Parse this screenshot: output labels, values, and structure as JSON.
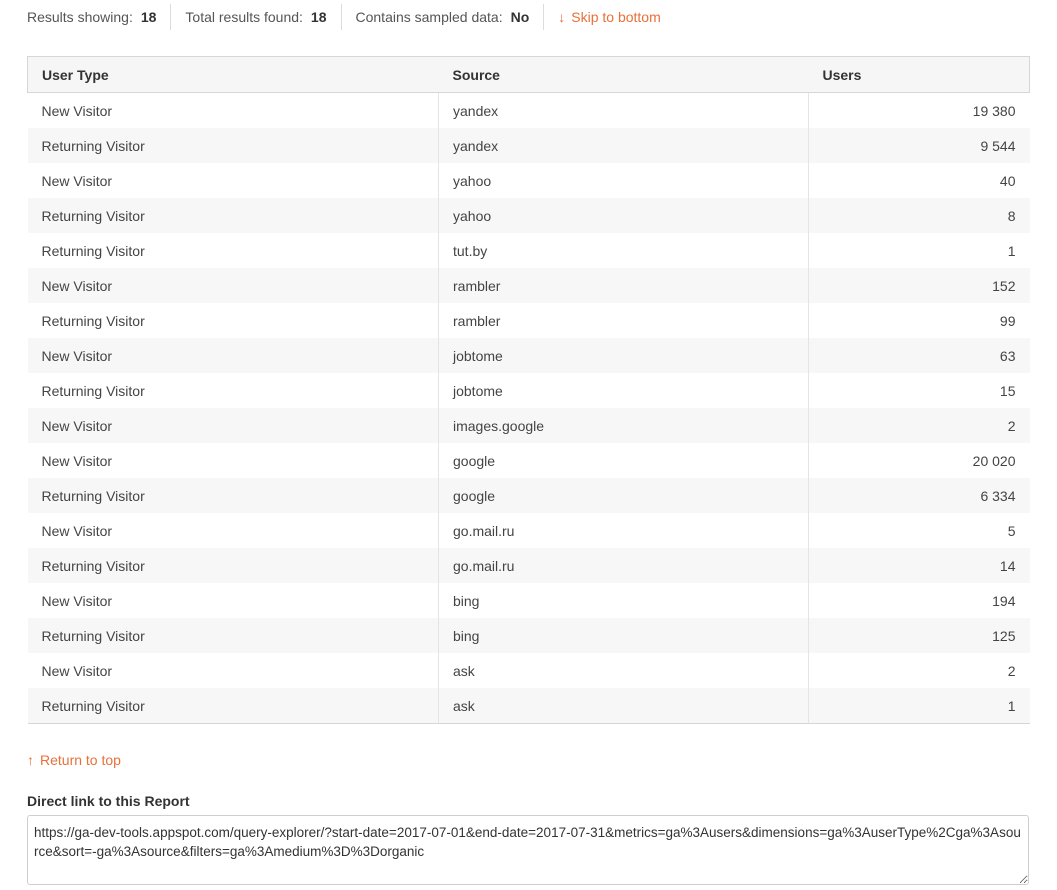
{
  "summary": {
    "results_showing_label": "Results showing:",
    "results_showing_value": "18",
    "total_found_label": "Total results found:",
    "total_found_value": "18",
    "sampled_label": "Contains sampled data:",
    "sampled_value": "No",
    "skip_arrow": "↓",
    "skip_label": "Skip to bottom"
  },
  "table": {
    "columns": [
      "User Type",
      "Source",
      "Users"
    ],
    "rows": [
      [
        "New Visitor",
        "yandex",
        "19 380"
      ],
      [
        "Returning Visitor",
        "yandex",
        "9 544"
      ],
      [
        "New Visitor",
        "yahoo",
        "40"
      ],
      [
        "Returning Visitor",
        "yahoo",
        "8"
      ],
      [
        "Returning Visitor",
        "tut.by",
        "1"
      ],
      [
        "New Visitor",
        "rambler",
        "152"
      ],
      [
        "Returning Visitor",
        "rambler",
        "99"
      ],
      [
        "New Visitor",
        "jobtome",
        "63"
      ],
      [
        "Returning Visitor",
        "jobtome",
        "15"
      ],
      [
        "New Visitor",
        "images.google",
        "2"
      ],
      [
        "New Visitor",
        "google",
        "20 020"
      ],
      [
        "Returning Visitor",
        "google",
        "6 334"
      ],
      [
        "New Visitor",
        "go.mail.ru",
        "5"
      ],
      [
        "Returning Visitor",
        "go.mail.ru",
        "14"
      ],
      [
        "New Visitor",
        "bing",
        "194"
      ],
      [
        "Returning Visitor",
        "bing",
        "125"
      ],
      [
        "New Visitor",
        "ask",
        "2"
      ],
      [
        "Returning Visitor",
        "ask",
        "1"
      ]
    ]
  },
  "footer": {
    "return_arrow": "↑",
    "return_label": "Return to top",
    "direct_link_label": "Direct link to this Report",
    "direct_link_value": "https://ga-dev-tools.appspot.com/query-explorer/?start-date=2017-07-01&end-date=2017-07-31&metrics=ga%3Ausers&dimensions=ga%3AuserType%2Cga%3Asource&sort=-ga%3Asource&filters=ga%3Amedium%3D%3Dorganic"
  },
  "colors": {
    "accent": "#e8703a",
    "row_stripe": "#f7f7f7",
    "header_bg": "#f6f6f6"
  }
}
